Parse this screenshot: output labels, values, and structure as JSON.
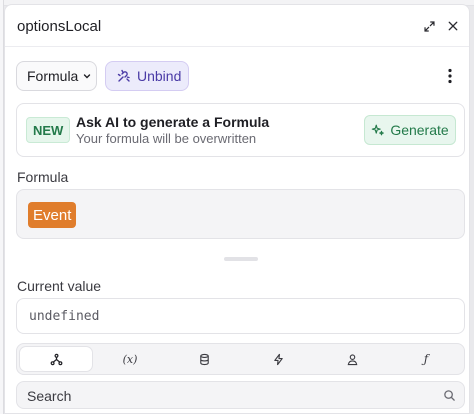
{
  "header": {
    "title": "optionsLocal",
    "expand_icon": "expand-icon",
    "close_icon": "close-icon"
  },
  "toolbar": {
    "mode_label": "Formula",
    "unbind_label": "Unbind",
    "more_icon": "kebab-icon"
  },
  "ai_card": {
    "badge": "NEW",
    "title": "Ask AI to generate a Formula",
    "subtitle": "Your formula will be overwritten",
    "generate_label": "Generate"
  },
  "formula": {
    "label": "Formula",
    "token": "Event"
  },
  "current_value": {
    "label": "Current value",
    "value": "undefined"
  },
  "tabs": [
    {
      "icon": "workflow-icon",
      "active": true
    },
    {
      "icon": "variable-icon",
      "text": "(x)"
    },
    {
      "icon": "database-icon"
    },
    {
      "icon": "lightning-icon"
    },
    {
      "icon": "user-icon"
    },
    {
      "icon": "function-icon",
      "text": "ƒ"
    }
  ],
  "search": {
    "placeholder": "Search"
  },
  "colors": {
    "accent_purple": "#4a3aa6",
    "accent_green": "#237a4a",
    "token_orange": "#e07d2c"
  }
}
